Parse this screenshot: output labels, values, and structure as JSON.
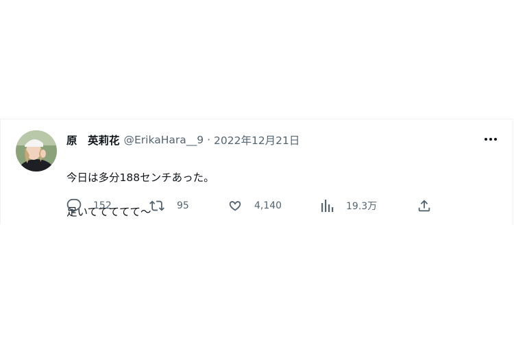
{
  "tweet": {
    "display_name": "原　英莉花",
    "handle": "@ErikaHara__9",
    "separator": "·",
    "date": "2022年12月21日",
    "text_line1": "今日は多分188センチあった。",
    "text_line2": "足いててててて〜",
    "avatar_icon": "profile-photo"
  },
  "actions": {
    "reply": {
      "icon": "reply-icon",
      "count": "152"
    },
    "retweet": {
      "icon": "retweet-icon",
      "count": "95"
    },
    "like": {
      "icon": "heart-icon",
      "count": "4,140"
    },
    "views": {
      "icon": "analytics-icon",
      "count": "19.3万"
    },
    "share": {
      "icon": "share-icon"
    }
  },
  "colors": {
    "text_primary": "#0f1419",
    "text_secondary": "#536471",
    "border": "#eff3f4"
  }
}
